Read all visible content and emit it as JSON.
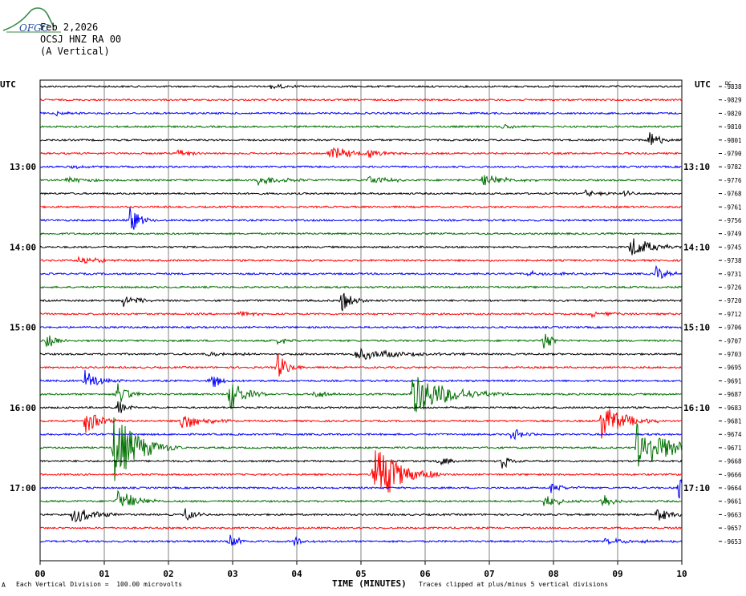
{
  "header": {
    "logo_text": "OFGC",
    "date": "Feb 2,2026",
    "station": "OCSJ HNZ RA 00",
    "component": "(A Vertical)"
  },
  "utc_left": "UTC",
  "utc_right": "UTC",
  "footer": {
    "scale_note": "Each Vertical Division =  100.00 microvolts",
    "clip_note": "Traces clipped at plus/minus 5 vertical divisions",
    "corner_mark": "A"
  },
  "chart_data": {
    "type": "line",
    "title": "",
    "xlabel": "TIME (MINUTES)",
    "ylabel": "",
    "x_ticks": [
      "00",
      "01",
      "02",
      "03",
      "04",
      "05",
      "06",
      "07",
      "08",
      "09",
      "10"
    ],
    "xlim": [
      0,
      10
    ],
    "left_time_labels": [
      {
        "row": 6,
        "label": "13:00"
      },
      {
        "row": 12,
        "label": "14:00"
      },
      {
        "row": 18,
        "label": "15:00"
      },
      {
        "row": 24,
        "label": "16:00"
      },
      {
        "row": 30,
        "label": "17:00"
      }
    ],
    "right_time_labels": [
      {
        "row": 6,
        "label": "13:10"
      },
      {
        "row": 12,
        "label": "14:10"
      },
      {
        "row": 18,
        "label": "15:10"
      },
      {
        "row": 24,
        "label": "16:10"
      },
      {
        "row": 30,
        "label": "17:10"
      }
    ],
    "dc_label": "DC",
    "trace_colors": [
      "#000000",
      "#ff0000",
      "#0000ff",
      "#007000"
    ],
    "trace_dc_offsets": [
      -9838,
      -9829,
      -9820,
      -9810,
      -9801,
      -9790,
      -9782,
      -9776,
      -9768,
      -9761,
      -9756,
      -9749,
      -9745,
      -9738,
      -9731,
      -9726,
      -9720,
      -9712,
      -9706,
      -9707,
      -9703,
      -9695,
      -9691,
      -9687,
      -9683,
      -9681,
      -9674,
      -9671,
      -9668,
      -9666,
      -9664,
      -9661,
      -9663,
      -9657,
      -9653
    ],
    "events": [
      {
        "row": 0,
        "t": 3.6,
        "amp": 3,
        "dur": 0.25
      },
      {
        "row": 2,
        "t": 0.25,
        "amp": 3,
        "dur": 0.2
      },
      {
        "row": 3,
        "t": 7.2,
        "amp": 3,
        "dur": 0.25
      },
      {
        "row": 4,
        "t": 9.5,
        "amp": 16,
        "dur": 0.12
      },
      {
        "row": 5,
        "t": 2.15,
        "amp": 7,
        "dur": 0.15
      },
      {
        "row": 5,
        "t": 4.5,
        "amp": 9,
        "dur": 0.35
      },
      {
        "row": 5,
        "t": 5.1,
        "amp": 6,
        "dur": 0.2
      },
      {
        "row": 6,
        "t": 0.5,
        "amp": 3,
        "dur": 0.15
      },
      {
        "row": 7,
        "t": 0.4,
        "amp": 4,
        "dur": 0.3
      },
      {
        "row": 7,
        "t": 3.4,
        "amp": 6,
        "dur": 0.4
      },
      {
        "row": 7,
        "t": 5.1,
        "amp": 6,
        "dur": 0.3
      },
      {
        "row": 7,
        "t": 6.9,
        "amp": 8,
        "dur": 0.3
      },
      {
        "row": 8,
        "t": 8.5,
        "amp": 4,
        "dur": 0.2
      },
      {
        "row": 8,
        "t": 9.1,
        "amp": 4,
        "dur": 0.15
      },
      {
        "row": 10,
        "t": 1.4,
        "amp": 18,
        "dur": 0.15
      },
      {
        "row": 12,
        "t": 9.2,
        "amp": 14,
        "dur": 0.3
      },
      {
        "row": 13,
        "t": 0.6,
        "amp": 6,
        "dur": 0.3
      },
      {
        "row": 14,
        "t": 7.6,
        "amp": 3,
        "dur": 0.4
      },
      {
        "row": 14,
        "t": 9.6,
        "amp": 10,
        "dur": 0.15
      },
      {
        "row": 16,
        "t": 1.3,
        "amp": 8,
        "dur": 0.2
      },
      {
        "row": 16,
        "t": 4.7,
        "amp": 16,
        "dur": 0.15
      },
      {
        "row": 17,
        "t": 3.1,
        "amp": 4,
        "dur": 0.2
      },
      {
        "row": 17,
        "t": 8.6,
        "amp": 4,
        "dur": 0.3
      },
      {
        "row": 19,
        "t": 0.1,
        "amp": 10,
        "dur": 0.15
      },
      {
        "row": 19,
        "t": 3.7,
        "amp": 5,
        "dur": 0.15
      },
      {
        "row": 19,
        "t": 7.85,
        "amp": 16,
        "dur": 0.1
      },
      {
        "row": 20,
        "t": 2.6,
        "amp": 3,
        "dur": 0.5
      },
      {
        "row": 20,
        "t": 4.9,
        "amp": 8,
        "dur": 0.6
      },
      {
        "row": 21,
        "t": 3.7,
        "amp": 18,
        "dur": 0.15
      },
      {
        "row": 22,
        "t": 0.7,
        "amp": 14,
        "dur": 0.2
      },
      {
        "row": 22,
        "t": 2.65,
        "amp": 12,
        "dur": 0.15
      },
      {
        "row": 23,
        "t": 1.2,
        "amp": 16,
        "dur": 0.15
      },
      {
        "row": 23,
        "t": 2.95,
        "amp": 22,
        "dur": 0.2
      },
      {
        "row": 23,
        "t": 4.25,
        "amp": 6,
        "dur": 0.2
      },
      {
        "row": 23,
        "t": 5.8,
        "amp": 28,
        "dur": 0.5
      },
      {
        "row": 24,
        "t": 1.2,
        "amp": 10,
        "dur": 0.15
      },
      {
        "row": 25,
        "t": 0.7,
        "amp": 18,
        "dur": 0.2
      },
      {
        "row": 25,
        "t": 2.2,
        "amp": 12,
        "dur": 0.3
      },
      {
        "row": 25,
        "t": 8.75,
        "amp": 26,
        "dur": 0.3
      },
      {
        "row": 26,
        "t": 7.35,
        "amp": 10,
        "dur": 0.15
      },
      {
        "row": 27,
        "t": 1.15,
        "amp": 45,
        "dur": 0.35
      },
      {
        "row": 27,
        "t": 9.3,
        "amp": 34,
        "dur": 0.45
      },
      {
        "row": 28,
        "t": 6.2,
        "amp": 6,
        "dur": 0.2
      },
      {
        "row": 28,
        "t": 7.2,
        "amp": 10,
        "dur": 0.12
      },
      {
        "row": 29,
        "t": 5.2,
        "amp": 45,
        "dur": 0.35
      },
      {
        "row": 30,
        "t": 7.95,
        "amp": 6,
        "dur": 0.2
      },
      {
        "row": 30,
        "t": 9.95,
        "amp": 14,
        "dur": 0.15
      },
      {
        "row": 31,
        "t": 1.2,
        "amp": 16,
        "dur": 0.25
      },
      {
        "row": 31,
        "t": 7.85,
        "amp": 10,
        "dur": 0.2
      },
      {
        "row": 31,
        "t": 8.75,
        "amp": 12,
        "dur": 0.15
      },
      {
        "row": 32,
        "t": 0.5,
        "amp": 12,
        "dur": 0.3
      },
      {
        "row": 32,
        "t": 2.25,
        "amp": 10,
        "dur": 0.15
      },
      {
        "row": 32,
        "t": 9.6,
        "amp": 10,
        "dur": 0.2
      },
      {
        "row": 34,
        "t": 2.95,
        "amp": 10,
        "dur": 0.15
      },
      {
        "row": 34,
        "t": 3.95,
        "amp": 7,
        "dur": 0.15
      },
      {
        "row": 34,
        "t": 8.8,
        "amp": 3,
        "dur": 0.6
      }
    ]
  }
}
